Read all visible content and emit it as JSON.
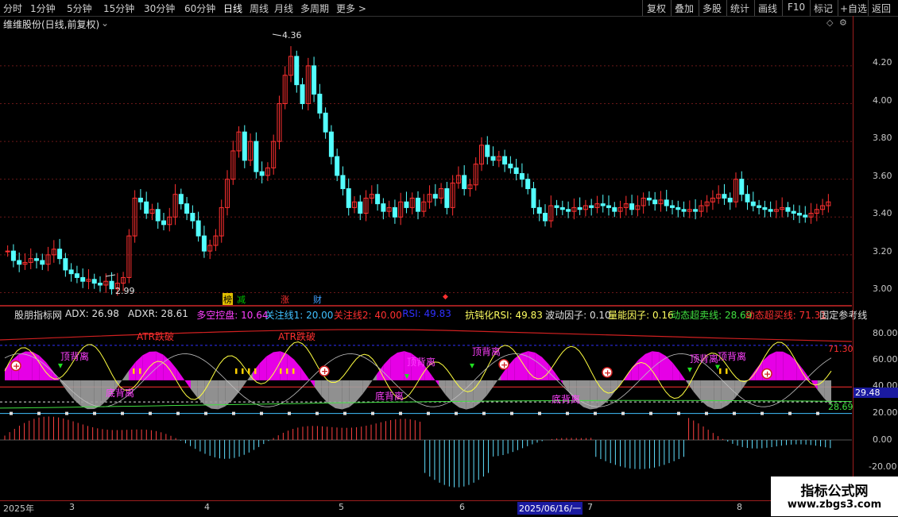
{
  "toolbar": {
    "periods": [
      "分时",
      "1分钟",
      "5分钟",
      "15分钟",
      "30分钟",
      "60分钟",
      "日线",
      "周线",
      "月线",
      "多周期",
      "更多 >"
    ],
    "active_period": "日线",
    "actions": [
      "复权",
      "叠加",
      "多股",
      "统计",
      "画线",
      "F10",
      "标记",
      "+自选",
      "返回"
    ]
  },
  "price_panel": {
    "title": "维维股份(日线,前复权)",
    "high_label": "4.36",
    "low_label": "2.99",
    "y_ticks": [
      "4.20",
      "4.00",
      "3.80",
      "3.60",
      "3.40",
      "3.20",
      "3.00"
    ],
    "markers": [
      {
        "text": "榜",
        "color": "#e0c000"
      },
      {
        "text": "减",
        "color": "#00c000"
      },
      {
        "text": "涨",
        "color": "#ff3030"
      },
      {
        "text": "财",
        "color": "#40a0ff"
      },
      {
        "text": "◆",
        "color": "#ff3030"
      }
    ]
  },
  "indicator": {
    "name": "股朋指标网",
    "labels": [
      {
        "text": "ADX: 26.98",
        "color": "#e0e0e0"
      },
      {
        "text": "ADXR: 28.61",
        "color": "#e0e0e0"
      },
      {
        "text": "多空控盘: 10.64",
        "color": "#ff40ff"
      },
      {
        "text": "关注线1: 20.00",
        "color": "#40c0ff"
      },
      {
        "text": "关注线2: 40.00",
        "color": "#ff3030"
      },
      {
        "text": "RSI: 49.83",
        "color": "#3030ff"
      },
      {
        "text": "抗钝化RSI: 49.83",
        "color": "#ffff60"
      },
      {
        "text": "波动因子: 0.10",
        "color": "#e0e0e0"
      },
      {
        "text": "量能因子: 0.16",
        "color": "#ffff60"
      },
      {
        "text": "动态超卖线: 28.69",
        "color": "#40e040"
      },
      {
        "text": "动态超买线: 71.31",
        "color": "#ff3030"
      },
      {
        "text": "固定参考线",
        "color": "#e0e0e0"
      }
    ],
    "y_ticks": [
      "80.00",
      "60.00",
      "40.00",
      "20.00",
      "0.00",
      "-20.00"
    ],
    "right_values": {
      "overbought": "71.30",
      "current": "29.48",
      "oversold": "28.69"
    },
    "annotations": {
      "top_div": "顶背离",
      "bottom_div": "底背离",
      "atr_break": "ATR跌破",
      "atr_break2": "ATR跌破"
    }
  },
  "date_axis": {
    "labels": [
      "2025年",
      "3",
      "4",
      "5",
      "6",
      "2025/06/16/一",
      "7",
      "8"
    ]
  },
  "watermark": {
    "title": "指标公式网",
    "url": "www.zbgs3.com"
  },
  "colors": {
    "up": "#ff3030",
    "down": "#54ffff",
    "magenta": "#ff00ff",
    "grey": "#a0a0a0",
    "axis": "#9c1e1e"
  }
}
